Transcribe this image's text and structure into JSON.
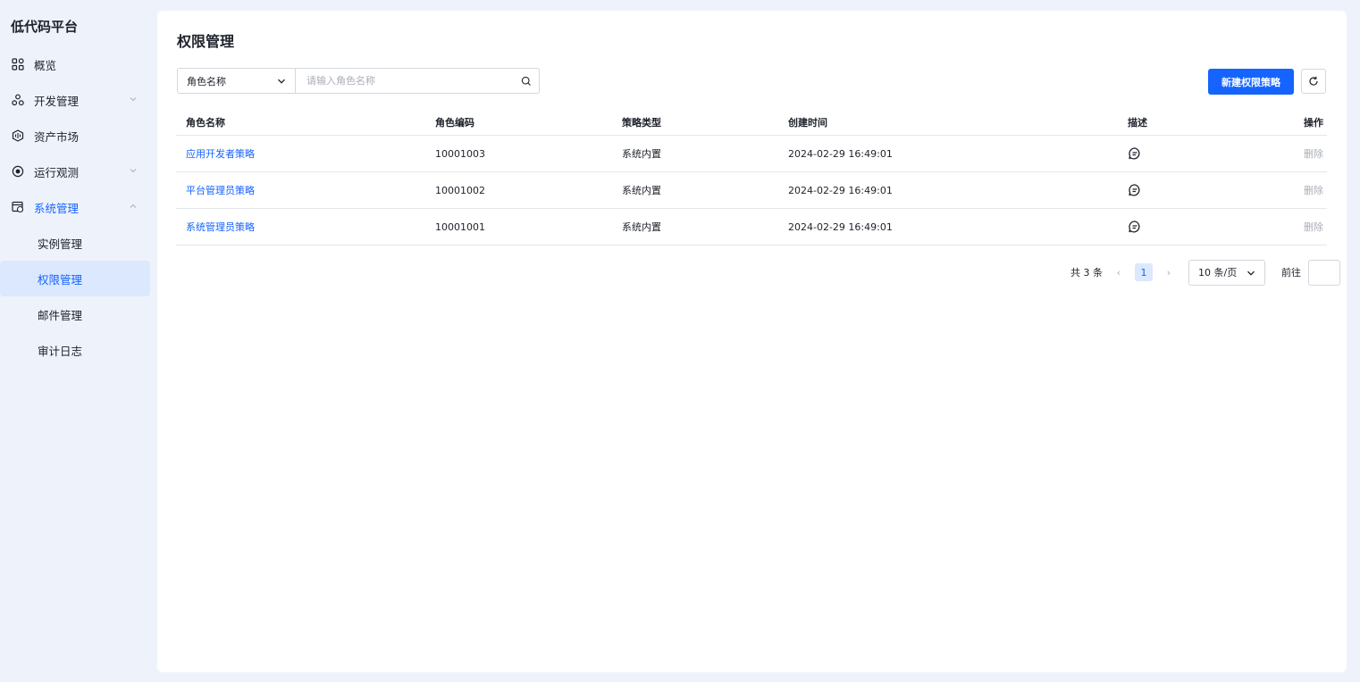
{
  "app": {
    "title": "低代码平台"
  },
  "sidebar": {
    "items": [
      {
        "label": "概览",
        "icon": "overview-icon"
      },
      {
        "label": "开发管理",
        "icon": "dev-icon",
        "expandable": true
      },
      {
        "label": "资产市场",
        "icon": "market-icon"
      },
      {
        "label": "运行观测",
        "icon": "observe-icon",
        "expandable": true
      },
      {
        "label": "系统管理",
        "icon": "system-icon",
        "expandable": true,
        "open": true
      }
    ],
    "sub_items": [
      "实例管理",
      "权限管理",
      "邮件管理",
      "审计日志"
    ],
    "active_sub": "权限管理"
  },
  "main": {
    "title": "权限管理",
    "search": {
      "field": "角色名称",
      "placeholder": "请输入角色名称"
    },
    "new_button": "新建权限策略",
    "table": {
      "headers": {
        "name": "角色名称",
        "code": "角色编码",
        "type": "策略类型",
        "time": "创建时间",
        "desc": "描述",
        "op": "操作"
      },
      "rows": [
        {
          "name": "应用开发者策略",
          "code": "10001003",
          "type": "系统内置",
          "time": "2024-02-29 16:49:01",
          "op": "删除"
        },
        {
          "name": "平台管理员策略",
          "code": "10001002",
          "type": "系统内置",
          "time": "2024-02-29 16:49:01",
          "op": "删除"
        },
        {
          "name": "系统管理员策略",
          "code": "10001001",
          "type": "系统内置",
          "time": "2024-02-29 16:49:01",
          "op": "删除"
        }
      ]
    },
    "pagination": {
      "total": "共 3 条",
      "current": "1",
      "page_size": "10 条/页",
      "goto": "前往"
    }
  },
  "colors": {
    "primary": "#1664ff",
    "bg": "#eef3fb",
    "active_bg": "#dbe8fd"
  }
}
